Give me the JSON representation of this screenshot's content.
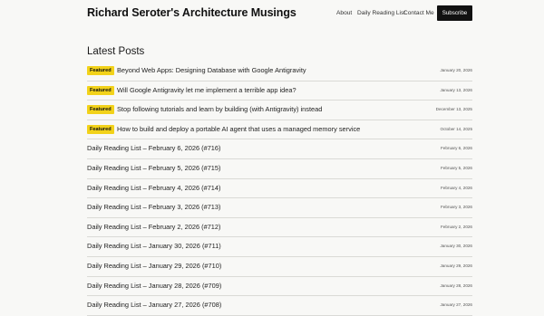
{
  "header": {
    "site_title": "Richard Seroter's Architecture Musings",
    "nav": [
      "About",
      "Daily Reading List",
      "Contact Me"
    ],
    "subscribe_label": "Subscribe"
  },
  "main": {
    "section_title": "Latest Posts",
    "badge_label": "Featured",
    "posts": [
      {
        "title": "Beyond Web Apps: Designing Database with Google Antigravity",
        "date": "January 20, 2026",
        "featured": true
      },
      {
        "title": "Will Google Antigravity let me implement a terrible app idea?",
        "date": "January 13, 2026",
        "featured": true
      },
      {
        "title": "Stop following tutorials and learn by building (with Antigravity) instead",
        "date": "December 13, 2025",
        "featured": true
      },
      {
        "title": "How to build and deploy a portable AI agent that uses a managed memory service",
        "date": "October 14, 2025",
        "featured": true
      },
      {
        "title": "Daily Reading List – February 6, 2026 (#716)",
        "date": "February 6, 2026",
        "featured": false
      },
      {
        "title": "Daily Reading List – February 5, 2026 (#715)",
        "date": "February 5, 2026",
        "featured": false
      },
      {
        "title": "Daily Reading List – February 4, 2026 (#714)",
        "date": "February 4, 2026",
        "featured": false
      },
      {
        "title": "Daily Reading List – February 3, 2026 (#713)",
        "date": "February 3, 2026",
        "featured": false
      },
      {
        "title": "Daily Reading List – February 2, 2026 (#712)",
        "date": "February 2, 2026",
        "featured": false
      },
      {
        "title": "Daily Reading List – January 30, 2026 (#711)",
        "date": "January 30, 2026",
        "featured": false
      },
      {
        "title": "Daily Reading List – January 29, 2026 (#710)",
        "date": "January 29, 2026",
        "featured": false
      },
      {
        "title": "Daily Reading List – January 28, 2026 (#709)",
        "date": "January 28, 2026",
        "featured": false
      },
      {
        "title": "Daily Reading List – January 27, 2026 (#708)",
        "date": "January 27, 2026",
        "featured": false
      }
    ]
  }
}
